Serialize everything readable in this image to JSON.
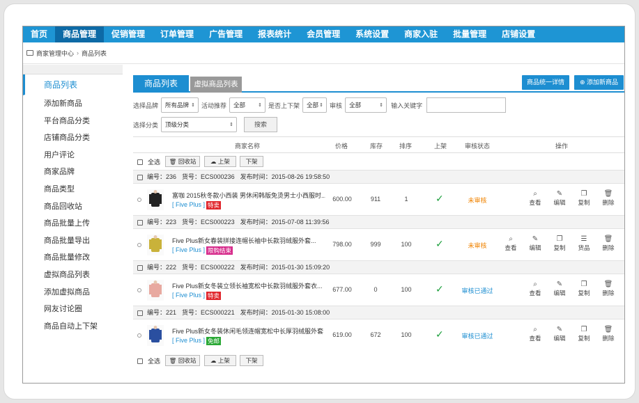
{
  "nav": [
    "首页",
    "商品管理",
    "促销管理",
    "订单管理",
    "广告管理",
    "报表统计",
    "会员管理",
    "系统设置",
    "商家入驻",
    "批量管理",
    "店铺设置"
  ],
  "breadcrumb": {
    "home": "商家管理中心",
    "sep": "›",
    "current": "商品列表"
  },
  "sidebar": [
    "商品列表",
    "添加新商品",
    "平台商品分类",
    "店铺商品分类",
    "用户评论",
    "商家品牌",
    "商品类型",
    "商品回收站",
    "商品批量上传",
    "商品批量导出",
    "商品批量修改",
    "虚拟商品列表",
    "添加虚拟商品",
    "网友讨论圈",
    "商品自动上下架"
  ],
  "tabs": {
    "active": "商品列表",
    "other": "虚拟商品列表"
  },
  "top_buttons": {
    "detail": "商品统一详情",
    "add": "添加新商品"
  },
  "filters": {
    "brand_label": "选择品牌",
    "brand_value": "所有品牌",
    "promo_label": "活动推荐",
    "promo_value": "全部",
    "onsale_label": "是否上下架",
    "onsale_value": "全部",
    "review_label": "审核",
    "review_value": "全部",
    "keyword_label": "输入关键字",
    "keyword_value": "",
    "category_label": "选择分类",
    "category_value": "顶级分类",
    "search_btn": "搜索"
  },
  "columns": {
    "name": "商家名称",
    "price": "价格",
    "stock": "库存",
    "sort": "排序",
    "onsale": "上架",
    "review": "审核状态",
    "ops": "操作"
  },
  "bulk": {
    "select_all": "全选",
    "recycle": "回收站",
    "up": "上架",
    "down": "下架"
  },
  "products": [
    {
      "id": "编号：236",
      "sn": "货号：ECS000236",
      "time": "发布时间：2015-08-26 19:58:50",
      "name": "富咖 2015秋冬款小西装 男休闲韩版免烫男士小西服时...",
      "brand": "[ Five Plus ]",
      "tag": "特卖",
      "tag_color": "#e0242b",
      "price": "600.00",
      "stock": "911",
      "sort": "1",
      "status": "未审核",
      "status_color": "#f08300",
      "actions": [
        "查看",
        "编辑",
        "复制",
        "删除"
      ]
    },
    {
      "id": "编号：223",
      "sn": "货号：ECS000223",
      "time": "发布时间：2015-07-08 11:39:56",
      "name": "Five Plus新女春装拼接连帽长袖中长款羽绒服外套...",
      "brand": "[ Five Plus ]",
      "tag": "限购结束",
      "tag_color": "#d62b8b",
      "price": "798.00",
      "stock": "999",
      "sort": "100",
      "status": "未审核",
      "status_color": "#f08300",
      "actions": [
        "查看",
        "编辑",
        "复制",
        "货品",
        "删除"
      ]
    },
    {
      "id": "编号：222",
      "sn": "货号：ECS000222",
      "time": "发布时间：2015-01-30 15:09:20",
      "name": "Five Plus新女冬装立领长袖宽松中长款羽绒服外套衣...",
      "brand": "[ Five Plus ]",
      "tag": "特卖",
      "tag_color": "#e0242b",
      "price": "677.00",
      "stock": "0",
      "sort": "100",
      "status": "审核已通过",
      "status_color": "#1d8ed1",
      "actions": [
        "查看",
        "编辑",
        "复制",
        "删除"
      ]
    },
    {
      "id": "编号：221",
      "sn": "货号：ECS000221",
      "time": "发布时间：2015-01-30 15:08:00",
      "name": "Five Plus新女冬装休闲毛领连帽宽松中长厚羽绒服外套",
      "brand": "[ Five Plus ]",
      "tag": "免邮",
      "tag_color": "#2aa835",
      "price": "619.00",
      "stock": "672",
      "sort": "100",
      "status": "审核已通过",
      "status_color": "#1d8ed1",
      "actions": [
        "查看",
        "编辑",
        "复制",
        "删除"
      ]
    }
  ],
  "icons": {
    "view": "search-icon",
    "edit": "edit-icon",
    "copy": "copy-icon",
    "goods": "list-icon",
    "delete": "trash-icon",
    "recycle": "trash-icon",
    "upload": "cloud-upload-icon"
  },
  "colors": {
    "primary": "#1d8ed1",
    "nav_active": "#0d6aa6"
  }
}
